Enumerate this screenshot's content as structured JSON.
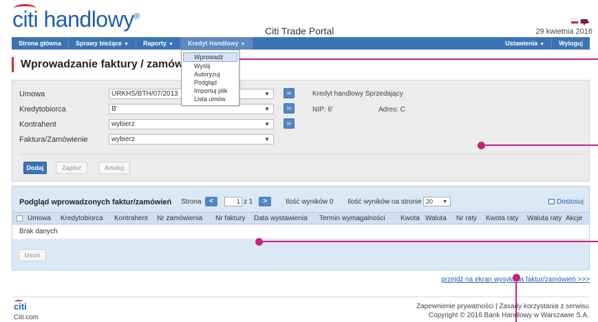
{
  "header": {
    "logo_text": "citi handlowy",
    "logo_mark": "®",
    "portal_title": "Citi Trade Portal",
    "date": "29 kwietnia 2016",
    "flags": [
      "pl-flag-icon",
      "gb-flag-icon"
    ]
  },
  "nav": {
    "items": [
      {
        "label": "Strona główna"
      },
      {
        "label": "Sprawy bieżące",
        "has_menu": true
      },
      {
        "label": "Raporty",
        "has_menu": true
      },
      {
        "label": "Kredyt Handlowy",
        "has_menu": true,
        "active": true
      }
    ],
    "right_items": [
      {
        "label": "Ustawienia",
        "has_menu": true
      },
      {
        "label": "Wyloguj"
      }
    ]
  },
  "dropdown": {
    "items": [
      "Wprowadź",
      "Wyślij",
      "Autoryzuj",
      "Podgląd",
      "Importuj plik",
      "Lista umów"
    ],
    "highlighted": "Wprowadź"
  },
  "page_title": "Wprowadzanie faktury / zamówienia",
  "form": {
    "rows": [
      {
        "label": "Umowa",
        "value": "URKHS/BTH/07/2013"
      },
      {
        "label": "Kredytobiorca",
        "value": "B'"
      },
      {
        "label": "Kontrahent",
        "value": "wybierz"
      },
      {
        "label": "Faktura/Zamówienie",
        "value": "wybierz"
      }
    ],
    "info": {
      "type": "Kredyt handlowy Sprzedający",
      "nip": "NIP: 6'",
      "address": "Adres: C"
    },
    "buttons": {
      "add": "Dodaj",
      "save": "Zapisz",
      "cancel": "Anuluj"
    }
  },
  "table_panel": {
    "title": "Podgląd wprowadzonych faktur/zamówień",
    "page_label": "Strona",
    "page_current": "1",
    "page_of": "z 1",
    "results_count": "Ilość wyników 0",
    "results_per_page_label": "Ilość wyników na stronie",
    "results_per_page": "20",
    "customize": "Dostosuj",
    "columns": [
      "Umowa",
      "Kredytobiorca",
      "Kontrahent",
      "Nr zamówienia",
      "Nr faktury",
      "Data wystawienia",
      "Termin wymagalności",
      "Kwota",
      "Waluta",
      "Nr raty",
      "Kwota raty",
      "Waluta raty",
      "Akcje"
    ],
    "empty_text": "Brak danych",
    "delete_button": "Usuń"
  },
  "goto_link": "przejdź na ekran wysyłania faktur/zamówień >>>",
  "footer": {
    "logo": "citi",
    "site": "Citi.com",
    "links": "Zapewnienie prywatności | Zasady korzystania z serwisu",
    "copyright": "Copyright © 2016 Bank Handlowy w Warszawie S.A."
  },
  "colors": {
    "brand_blue": "#1d5fa8",
    "nav_blue": "#3c73b5",
    "brand_red": "#d9262c",
    "callout_magenta": "#cc1f7a",
    "table_panel_bg": "#dbe9f7"
  }
}
